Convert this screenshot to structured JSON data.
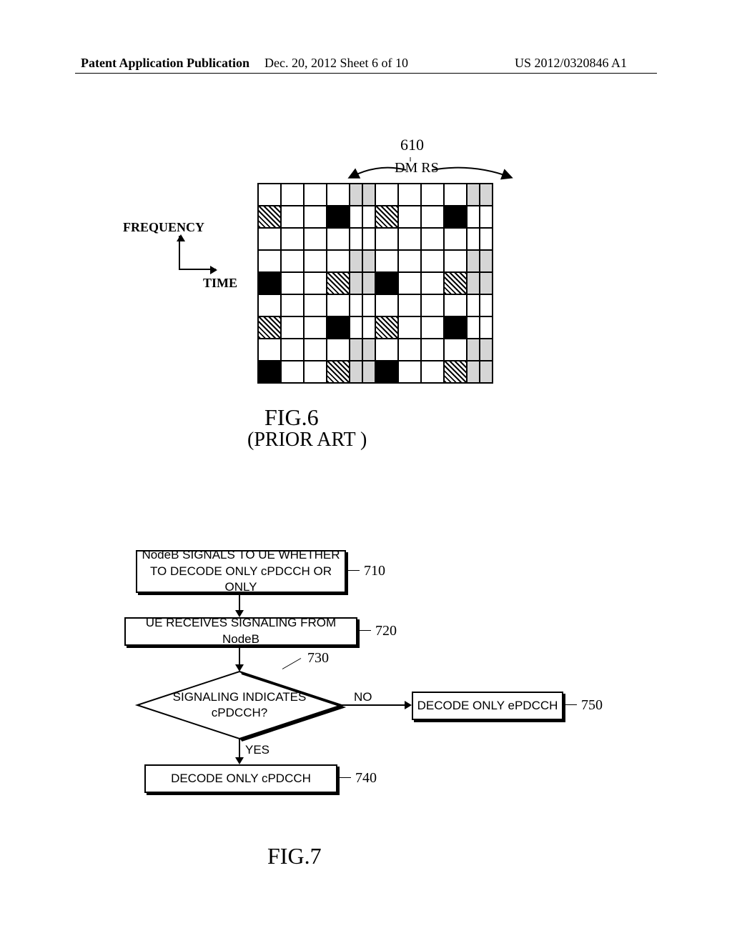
{
  "header": {
    "left": "Patent Application Publication",
    "center": "Dec. 20, 2012  Sheet 6 of 10",
    "right": "US 2012/0320846 A1"
  },
  "fig6": {
    "ref610": "610",
    "dmrs": "DM RS",
    "axis_freq": "FREQUENCY",
    "axis_time": "TIME",
    "title": "FIG.6",
    "subtitle": "(PRIOR ART )"
  },
  "fig7": {
    "step710": "NodeB SIGNALS TO UE WHETHER\nTO DECODE ONLY cPDCCH OR ONLY",
    "ref710": "710",
    "step720": "UE RECEIVES SIGNALING FROM NodeB",
    "ref720": "720",
    "step730": "SIGNALING INDICATES\ncPDCCH?",
    "ref730": "730",
    "step740": "DECODE ONLY cPDCCH",
    "ref740": "740",
    "step750": "DECODE ONLY ePDCCH",
    "ref750": "750",
    "yes": "YES",
    "no": "NO",
    "title": "FIG.7"
  }
}
